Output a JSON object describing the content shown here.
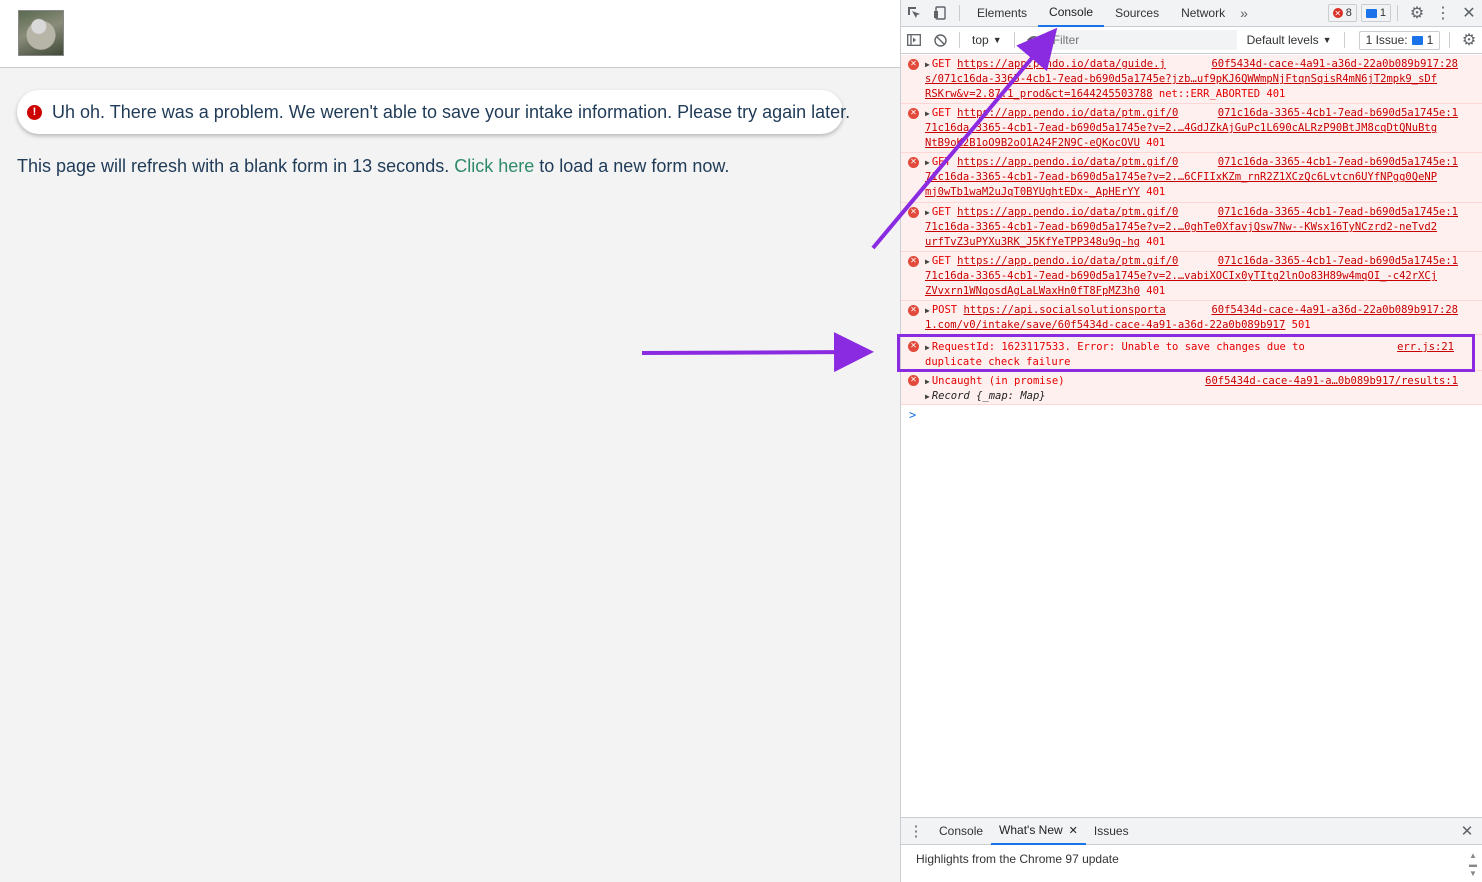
{
  "page": {
    "alert_text": "Uh oh. There was a problem. We weren't able to save your intake information. Please try again later.",
    "alert_icon": "!",
    "refresh_prefix": "This page will refresh with a blank form in 13 seconds. ",
    "refresh_link": "Click here",
    "refresh_suffix": " to load a new form now."
  },
  "devtools": {
    "tabs": [
      "Elements",
      "Console",
      "Sources",
      "Network"
    ],
    "more_tabs": "»",
    "error_count": "8",
    "message_count": "1",
    "context": "top",
    "filter_placeholder": "Filter",
    "levels": "Default levels",
    "issues_label": "1 Issue:",
    "issues_count": "1",
    "prompt": ">",
    "messages": [
      {
        "method": "GET",
        "url": "https://app.pendo.io/data/guide.j",
        "source": "60f5434d-cace-4a91-a36d-22a0b089b917:28",
        "line2": "s/071c16da-3365-4cb1-7ead-b690d5a1745e?jzb…uf9pKJ6QWWmpNjFtqnSqisR4mN6jT2mpk9_sDf",
        "line3": "RSKrw&v=2.87.1_prod&ct=1644245503788",
        "status": "net::ERR_ABORTED 401"
      },
      {
        "method": "GET",
        "url": "https://app.pendo.io/data/ptm.gif/0",
        "source": "071c16da-3365-4cb1-7ead-b690d5a1745e:1",
        "line2": "71c16da-3365-4cb1-7ead-b690d5a1745e?v=2.…4GdJZkAjGuPc1L690cALRzP90BtJM8cqDtQNuBtg",
        "line3": "NtB9oK2B1oO9B2oO1A24F2N9C-eQKocOVU",
        "status": "401"
      },
      {
        "method": "GET",
        "url": "https://app.pendo.io/data/ptm.gif/0",
        "source": "071c16da-3365-4cb1-7ead-b690d5a1745e:1",
        "line2": "71c16da-3365-4cb1-7ead-b690d5a1745e?v=2.…6CFIIxKZm_rnR2Z1XCzQc6Lvtcn6UYfNPgg0QeNP",
        "line3": "mj0wTb1waM2uJqT0BYUghtEDx-_ApHErYY",
        "status": "401"
      },
      {
        "method": "GET",
        "url": "https://app.pendo.io/data/ptm.gif/0",
        "source": "071c16da-3365-4cb1-7ead-b690d5a1745e:1",
        "line2": "71c16da-3365-4cb1-7ead-b690d5a1745e?v=2.…0ghTe0XfavjQsw7Nw--KWsx16TyNCzrd2-neTvd2",
        "line3": "urfTvZ3uPYXu3RK_J5KfYeTPP348u9q-hg",
        "status": "401"
      },
      {
        "method": "GET",
        "url": "https://app.pendo.io/data/ptm.gif/0",
        "source": "071c16da-3365-4cb1-7ead-b690d5a1745e:1",
        "line2": "71c16da-3365-4cb1-7ead-b690d5a1745e?v=2.…vabiXOCIx0yTItg2lnOo83H89w4mqOI_-c42rXCj",
        "line3": "ZVvxrn1WNqosdAgLaLWaxHn0fT8FpMZ3h0",
        "status": "401"
      },
      {
        "method": "POST",
        "url": "https://api.socialsolutionsporta",
        "source": "60f5434d-cace-4a91-a36d-22a0b089b917:28",
        "line2": "1.com/v0/intake/save/60f5434d-cace-4a91-a36d-22a0b089b917",
        "line3": "",
        "status": "501"
      }
    ],
    "request_error": {
      "text1": "RequestId: 1623117533. Error: Unable to save changes due to",
      "text2": "duplicate check failure",
      "source": "err.js:21"
    },
    "uncaught": {
      "text": "Uncaught (in promise)",
      "source": "60f5434d-cace-4a91-a…0b089b917/results:1",
      "record": "Record {_map: Map}"
    },
    "drawer_tabs": [
      "Console",
      "What's New",
      "Issues"
    ],
    "drawer_text": "Highlights from the Chrome 97 update"
  },
  "colors": {
    "arrow": "#8a2be2",
    "error": "#e50000",
    "accent": "#1a73e8"
  }
}
